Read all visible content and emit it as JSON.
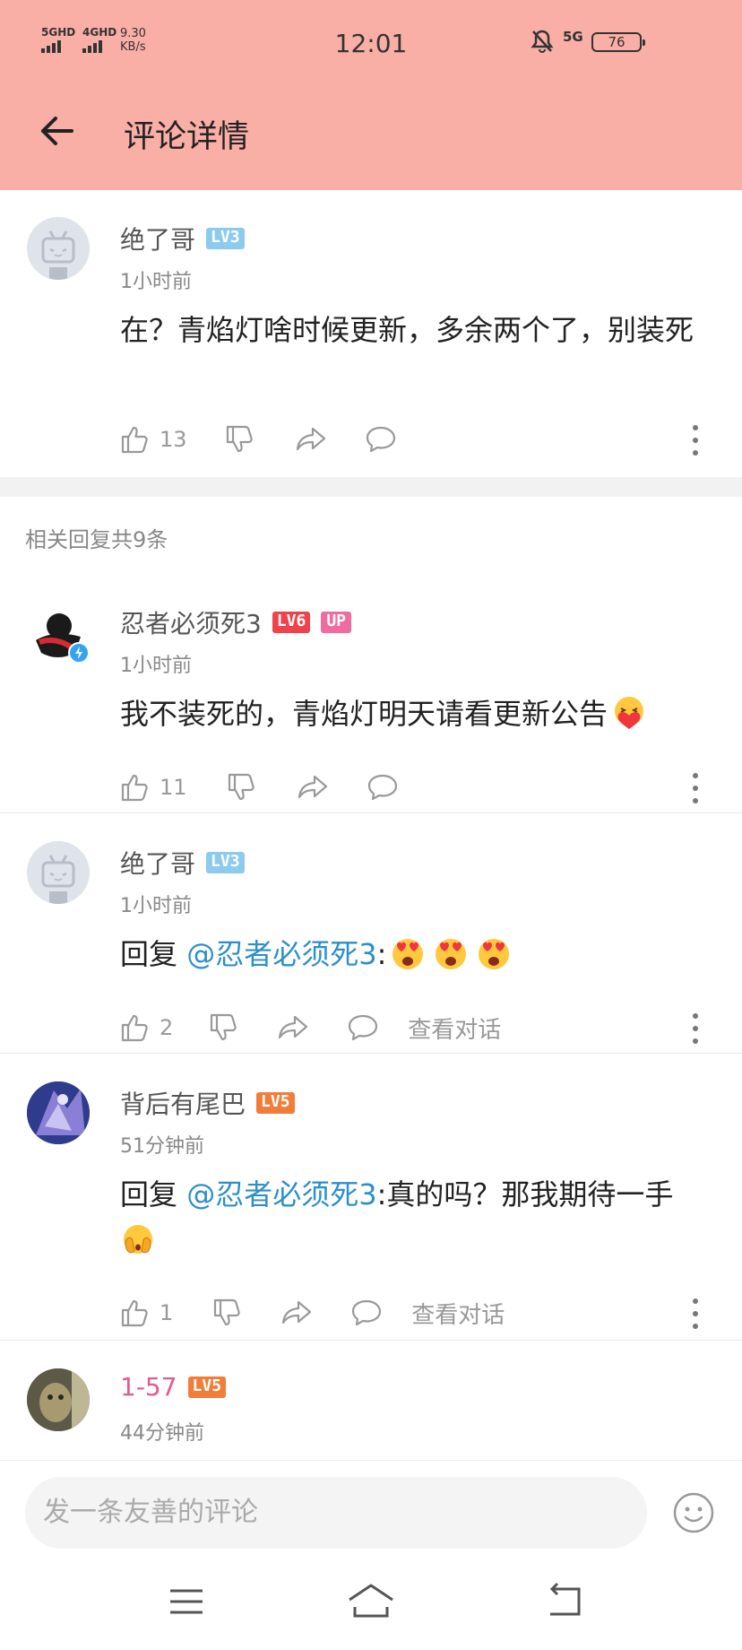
{
  "status_bar": {
    "sim1": "5GHD",
    "sim2": "4GHD",
    "net_speed_value": "9.30",
    "net_speed_unit": "KB/s",
    "time": "12:01",
    "network": "5G",
    "battery": "76"
  },
  "header": {
    "title": "评论详情",
    "back_icon": "back-arrow-icon"
  },
  "main_comment": {
    "user": "绝了哥",
    "level": "LV3",
    "time": "1小时前",
    "text": "在？青焰灯啥时候更新，多余两个了，别装死",
    "likes": "13"
  },
  "replies_header": "相关回复共9条",
  "replies": [
    {
      "user": "忍者必须死3",
      "level": "LV6",
      "badge": "UP",
      "time": "1小时前",
      "text": "我不装死的，青焰灯明天请看更新公告",
      "likes": "11"
    },
    {
      "user": "绝了哥",
      "level": "LV3",
      "time": "1小时前",
      "reply_prefix": "回复",
      "mention": "@忍者必须死3",
      "text": ":",
      "likes": "2",
      "view_conversation": "查看对话"
    },
    {
      "user": "背后有尾巴",
      "level": "LV5",
      "time": "51分钟前",
      "reply_prefix": "回复",
      "mention": "@忍者必须死3",
      "text": ":真的吗？那我期待一手",
      "likes": "1",
      "view_conversation": "查看对话"
    },
    {
      "user": "1-57",
      "level": "LV5",
      "time": "44分钟前"
    }
  ],
  "input": {
    "placeholder": "发一条友善的评论"
  },
  "colors": {
    "header_bg": "#f9aea6",
    "mention": "#2c8fc9",
    "lv3": "#8ccbec",
    "lv5": "#f07e3a",
    "lv6": "#f0424c",
    "up_badge": "#f06b9f",
    "pink_name": "#e8578f"
  }
}
